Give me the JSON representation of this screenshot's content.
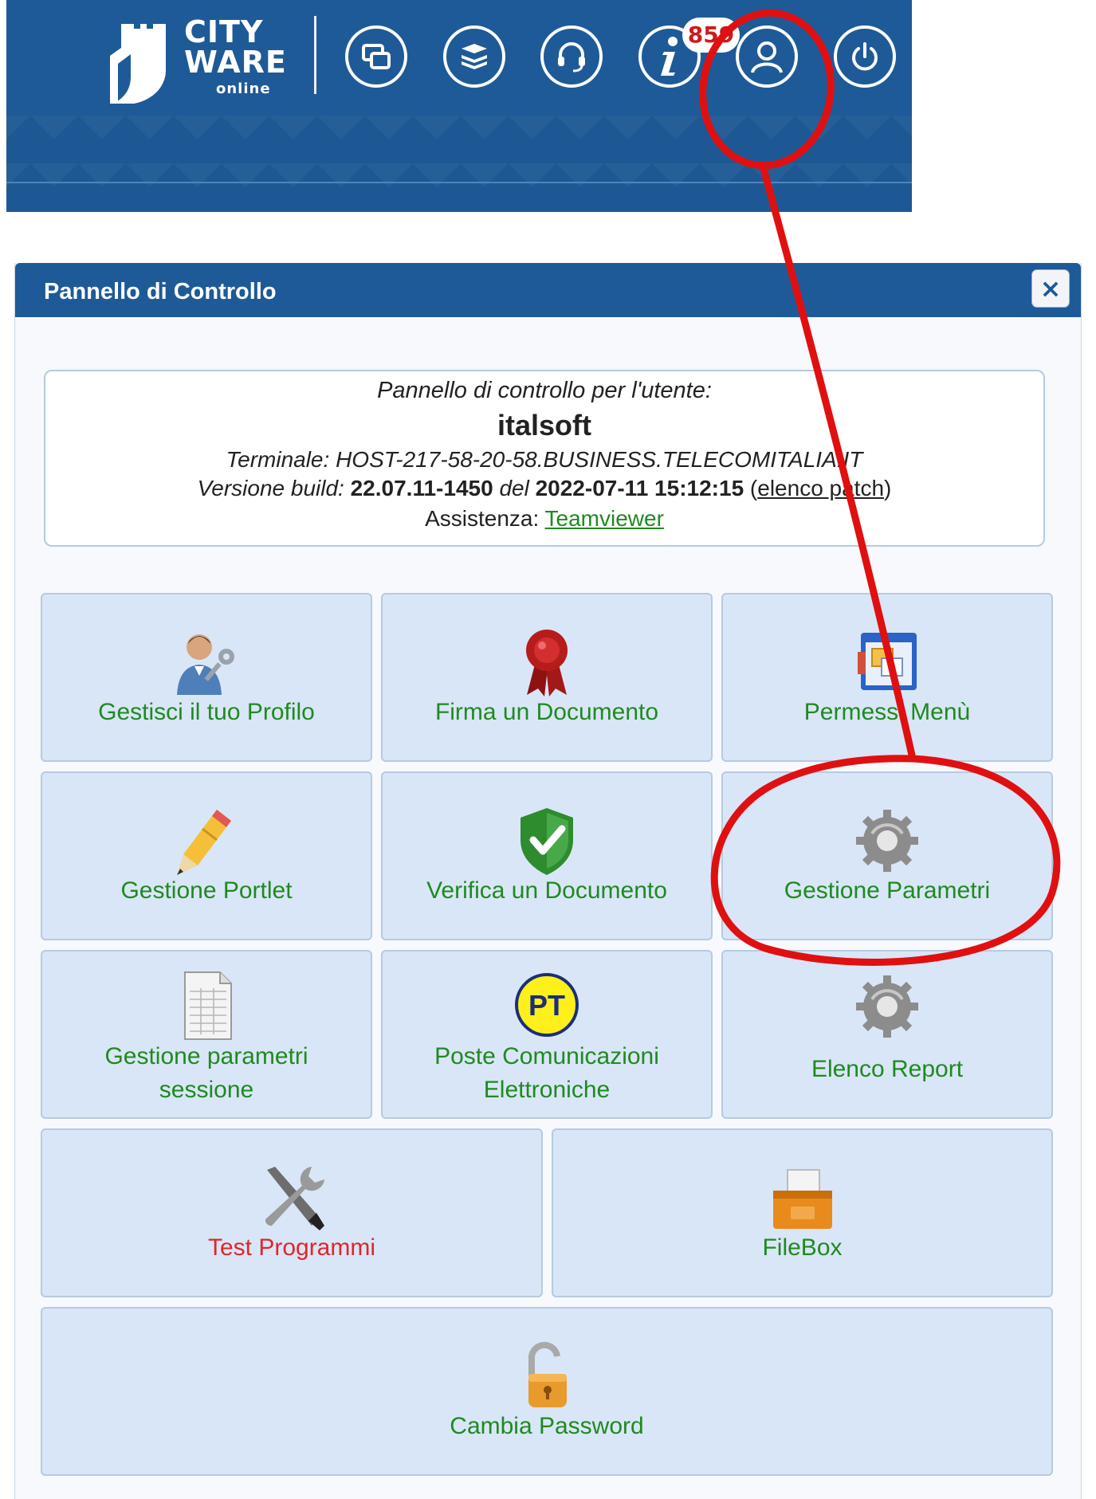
{
  "topbar": {
    "logo": {
      "line1": "CITY",
      "line2": "WARE",
      "line3": "online"
    },
    "icons": [
      "windows-icon",
      "books-icon",
      "headset-icon",
      "info-icon",
      "user-icon",
      "power-icon"
    ],
    "badge": "859",
    "color": "#1e5a98"
  },
  "panel": {
    "title": "Pannello di Controllo",
    "close_label": "×",
    "info": {
      "line1": "Pannello di controllo per l'utente:",
      "user": "italsoft",
      "terminal": "Terminale: HOST-217-58-20-58.BUSINESS.TELECOMITALIA.IT",
      "build_label": "Versione build:",
      "build": "22.07.11-1450",
      "del": "del",
      "date": "2022-07-11 15:12:15",
      "patch_open": "(",
      "patch_link": "elenco patch",
      "patch_close": ")",
      "assist_label": "Assistenza:",
      "assist_link": "Teamviewer"
    },
    "tiles": [
      {
        "label": "Gestisci il tuo Profilo",
        "icon": "user-key-icon"
      },
      {
        "label": "Firma un Documento",
        "icon": "ribbon-seal-icon"
      },
      {
        "label": "Permessi Menù",
        "icon": "window-permissions-icon"
      },
      {
        "label": "Gestione Portlet",
        "icon": "pencil-icon"
      },
      {
        "label": "Verifica un Documento",
        "icon": "shield-check-icon"
      },
      {
        "label": "Gestione Parametri",
        "icon": "gear-icon"
      },
      {
        "label_a": "Gestione parametri",
        "label_b": "sessione",
        "icon": "spreadsheet-icon"
      },
      {
        "label_a": "Poste Comunicazioni",
        "label_b": "Elettroniche",
        "icon": "pt-icon",
        "icon_text": "PT"
      },
      {
        "label": "Elenco Report",
        "icon": "gear-icon"
      },
      {
        "label": "Test Programmi",
        "icon": "tools-icon"
      },
      {
        "label": "FileBox",
        "icon": "filebox-icon"
      },
      {
        "label": "Cambia Password",
        "icon": "padlock-open-icon"
      }
    ],
    "colors": {
      "tile_bg": "#d9e6f7",
      "label_green": "#1f8a1f",
      "label_red": "#e0262b"
    }
  },
  "annotation": {
    "color": "#e01010"
  }
}
